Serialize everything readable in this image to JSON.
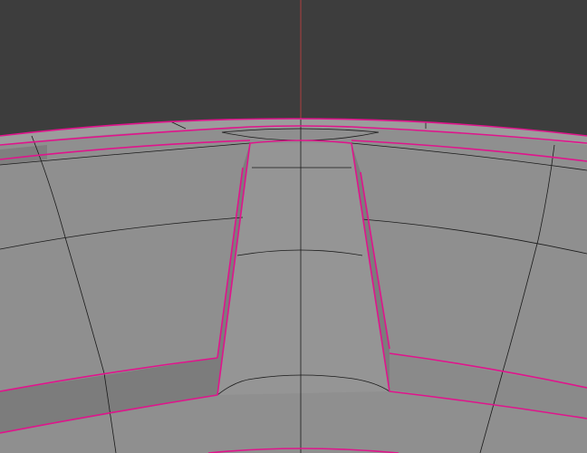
{
  "viewport": {
    "background_color": "#3d3d3d",
    "mesh_face_color": "#8f8f8f",
    "mesh_face_light_color": "#9a9a9a",
    "mesh_face_dark_color": "#7e7e7e",
    "wire_color": "#1a1a1a",
    "seam_color": "#e0148c",
    "axis_line_color": "#b04040"
  }
}
